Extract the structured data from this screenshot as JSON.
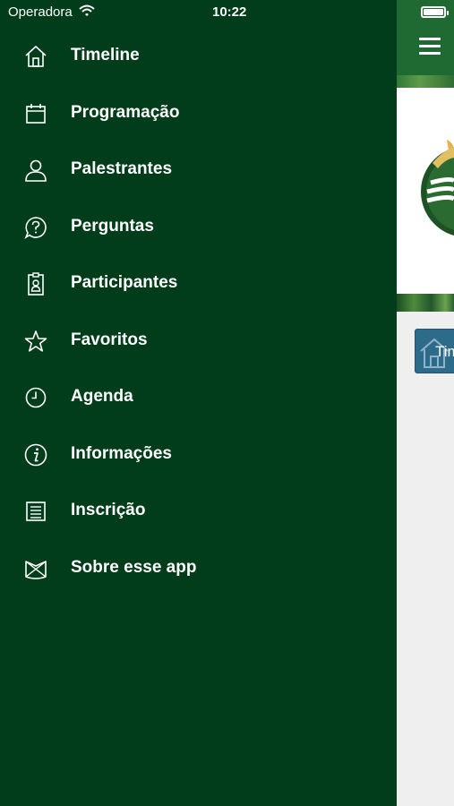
{
  "status_bar": {
    "carrier": "Operadora",
    "time": "10:22",
    "icons": [
      "wifi-icon",
      "battery-icon"
    ]
  },
  "drawer": {
    "items": [
      {
        "label": "Timeline",
        "icon": "home-icon"
      },
      {
        "label": "Programação",
        "icon": "calendar-icon"
      },
      {
        "label": "Palestrantes",
        "icon": "person-icon"
      },
      {
        "label": "Perguntas",
        "icon": "question-bubble-icon"
      },
      {
        "label": "Participantes",
        "icon": "badge-icon"
      },
      {
        "label": "Favoritos",
        "icon": "star-icon"
      },
      {
        "label": "Agenda",
        "icon": "clock-icon"
      },
      {
        "label": "Informações",
        "icon": "info-icon"
      },
      {
        "label": "Inscrição",
        "icon": "form-icon"
      },
      {
        "label": "Sobre esse app",
        "icon": "app-logo-icon"
      }
    ]
  },
  "app": {
    "menu_icon": "hamburger-icon",
    "timeline_button_label": "Tim"
  },
  "colors": {
    "drawer_bg": "#013d1a",
    "topbar_bg": "#1f6a33",
    "content_bg": "#efefef",
    "button_bg": "#2c6b8a",
    "text": "#ffffff"
  }
}
